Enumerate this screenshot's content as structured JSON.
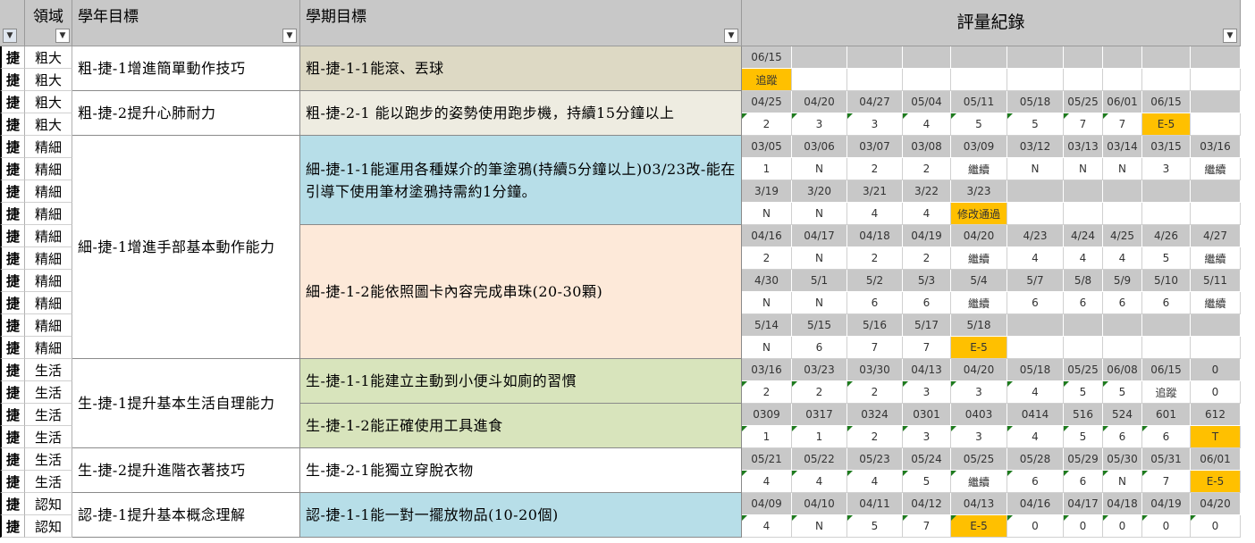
{
  "headers": {
    "domain": "領域",
    "year_goal": "學年目標",
    "semester_goal": "學期目標",
    "evaluation": "評量紀錄",
    "filter_icon": "filter-icon",
    "dropdown_icon": "chevron-down-icon"
  },
  "colors": {
    "header_bg": "#c8c8c8",
    "highlight": "#ffc000",
    "beige": "#ddd9c4",
    "beige_light": "#eeece1",
    "blue": "#b7dee8",
    "peach": "#fde9d9",
    "green": "#d8e4bc",
    "white": "#ffffff",
    "comment_marker": "#1e7b1e"
  },
  "rows": [
    {
      "idx": "捷",
      "domain": "粗大"
    },
    {
      "idx": "捷",
      "domain": "粗大"
    },
    {
      "idx": "捷",
      "domain": "粗大"
    },
    {
      "idx": "捷",
      "domain": "粗大"
    },
    {
      "idx": "捷",
      "domain": "精細"
    },
    {
      "idx": "捷",
      "domain": "精細"
    },
    {
      "idx": "捷",
      "domain": "精細"
    },
    {
      "idx": "捷",
      "domain": "精細"
    },
    {
      "idx": "捷",
      "domain": "精細"
    },
    {
      "idx": "捷",
      "domain": "精細"
    },
    {
      "idx": "捷",
      "domain": "精細"
    },
    {
      "idx": "捷",
      "domain": "精細"
    },
    {
      "idx": "捷",
      "domain": "精細"
    },
    {
      "idx": "捷",
      "domain": "精細"
    },
    {
      "idx": "捷",
      "domain": "生活"
    },
    {
      "idx": "捷",
      "domain": "生活"
    },
    {
      "idx": "捷",
      "domain": "生活"
    },
    {
      "idx": "捷",
      "domain": "生活"
    },
    {
      "idx": "捷",
      "domain": "生活"
    },
    {
      "idx": "捷",
      "domain": "生活"
    },
    {
      "idx": "捷",
      "domain": "認知"
    },
    {
      "idx": "捷",
      "domain": "認知"
    }
  ],
  "year_goals": [
    {
      "text": "粗-捷-1增進簡單動作技巧",
      "start": 0,
      "span": 2
    },
    {
      "text": "粗-捷-2提升心肺耐力",
      "start": 2,
      "span": 2
    },
    {
      "text": "細-捷-1增進手部基本動作能力",
      "start": 4,
      "span": 10
    },
    {
      "text": "生-捷-1提升基本生活自理能力",
      "start": 14,
      "span": 4
    },
    {
      "text": "生-捷-2提升進階衣著技巧",
      "start": 18,
      "span": 2
    },
    {
      "text": "認-捷-1提升基本概念理解",
      "start": 20,
      "span": 2
    }
  ],
  "semester_goals": [
    {
      "text": "粗-捷-1-1能滾、丟球",
      "start": 0,
      "span": 2,
      "color": "beige"
    },
    {
      "text": "粗-捷-2-1 能以跑步的姿勢使用跑步機，持續15分鐘以上",
      "start": 2,
      "span": 2,
      "color": "beige_light"
    },
    {
      "text": "細-捷-1-1能運用各種媒介的筆塗鴉(持續5分鐘以上)03/23改-能在引導下使用筆材塗鴉持需約1分鐘。",
      "start": 4,
      "span": 4,
      "color": "blue"
    },
    {
      "text": "細-捷-1-2能依照圖卡內容完成串珠(20-30顆)",
      "start": 8,
      "span": 6,
      "color": "peach"
    },
    {
      "text": "生-捷-1-1能建立主動到小便斗如廁的習慣",
      "start": 14,
      "span": 2,
      "color": "green"
    },
    {
      "text": "生-捷-1-2能正確使用工具進食",
      "start": 16,
      "span": 2,
      "color": "green"
    },
    {
      "text": "生-捷-2-1能獨立穿脫衣物",
      "start": 18,
      "span": 2,
      "color": "white"
    },
    {
      "text": "認-捷-1-1能一對一擺放物品(10-20個)",
      "start": 20,
      "span": 2,
      "color": "blue"
    }
  ],
  "evaluation": [
    {
      "type": "d",
      "cells": [
        "06/15",
        "",
        "",
        "",
        "",
        "",
        "",
        "",
        "",
        ""
      ]
    },
    {
      "type": "s",
      "cells": [
        "追蹤",
        "",
        "",
        "",
        "",
        "",
        "",
        "",
        "",
        ""
      ],
      "highlight": [
        0
      ]
    },
    {
      "type": "d",
      "cells": [
        "04/25",
        "04/20",
        "04/27",
        "05/04",
        "05/11",
        "05/18",
        "05/25",
        "06/01",
        "06/15",
        ""
      ]
    },
    {
      "type": "s",
      "cells": [
        "2",
        "3",
        "3",
        "4",
        "5",
        "5",
        "7",
        "7",
        "E-5",
        ""
      ],
      "highlight": [
        8
      ],
      "marks": [
        0,
        1,
        2,
        3,
        4,
        5,
        6,
        7
      ]
    },
    {
      "type": "d",
      "cells": [
        "03/05",
        "03/06",
        "03/07",
        "03/08",
        "03/09",
        "03/12",
        "03/13",
        "03/14",
        "03/15",
        "03/16"
      ]
    },
    {
      "type": "s",
      "cells": [
        "1",
        "N",
        "2",
        "2",
        "繼續",
        "N",
        "N",
        "N",
        "3",
        "繼續"
      ]
    },
    {
      "type": "d",
      "cells": [
        "3/19",
        "3/20",
        "3/21",
        "3/22",
        "3/23",
        "",
        "",
        "",
        "",
        ""
      ]
    },
    {
      "type": "s",
      "cells": [
        "N",
        "N",
        "4",
        "4",
        "修改通過",
        "",
        "",
        "",
        "",
        ""
      ],
      "highlight": [
        4
      ]
    },
    {
      "type": "d",
      "cells": [
        "04/16",
        "04/17",
        "04/18",
        "04/19",
        "04/20",
        "4/23",
        "4/24",
        "4/25",
        "4/26",
        "4/27"
      ]
    },
    {
      "type": "s",
      "cells": [
        "2",
        "N",
        "2",
        "2",
        "繼續",
        "4",
        "4",
        "4",
        "5",
        "繼續"
      ]
    },
    {
      "type": "d",
      "cells": [
        "4/30",
        "5/1",
        "5/2",
        "5/3",
        "5/4",
        "5/7",
        "5/8",
        "5/9",
        "5/10",
        "5/11"
      ]
    },
    {
      "type": "s",
      "cells": [
        "N",
        "N",
        "6",
        "6",
        "繼續",
        "6",
        "6",
        "6",
        "6",
        "繼續"
      ]
    },
    {
      "type": "d",
      "cells": [
        "5/14",
        "5/15",
        "5/16",
        "5/17",
        "5/18",
        "",
        "",
        "",
        "",
        ""
      ]
    },
    {
      "type": "s",
      "cells": [
        "N",
        "6",
        "7",
        "7",
        "E-5",
        "",
        "",
        "",
        "",
        ""
      ],
      "highlight": [
        4
      ]
    },
    {
      "type": "d",
      "cells": [
        "03/16",
        "03/23",
        "03/30",
        "04/13",
        "04/20",
        "05/18",
        "05/25",
        "06/08",
        "06/15",
        "0"
      ]
    },
    {
      "type": "s",
      "cells": [
        "2",
        "2",
        "2",
        "3",
        "3",
        "4",
        "5",
        "5",
        "追蹤",
        "0"
      ],
      "marks": [
        0,
        1,
        2,
        3,
        4,
        5,
        6,
        7
      ]
    },
    {
      "type": "d",
      "cells": [
        "0309",
        "0317",
        "0324",
        "0301",
        "0403",
        "0414",
        "516",
        "524",
        "601",
        "612"
      ]
    },
    {
      "type": "s",
      "cells": [
        "1",
        "1",
        "2",
        "3",
        "3",
        "4",
        "5",
        "6",
        "6",
        "T"
      ],
      "highlight": [
        9
      ],
      "marks": [
        0,
        1,
        2,
        3,
        4,
        5,
        6,
        7,
        8
      ]
    },
    {
      "type": "d",
      "cells": [
        "05/21",
        "05/22",
        "05/23",
        "05/24",
        "05/25",
        "05/28",
        "05/29",
        "05/30",
        "05/31",
        "06/01"
      ]
    },
    {
      "type": "s",
      "cells": [
        "4",
        "4",
        "4",
        "5",
        "繼續",
        "6",
        "6",
        "N",
        "7",
        "E-5"
      ],
      "highlight": [
        9
      ],
      "marks": [
        0,
        1,
        2,
        3,
        4,
        5,
        6,
        7,
        8
      ]
    },
    {
      "type": "d",
      "cells": [
        "04/09",
        "04/10",
        "04/11",
        "04/12",
        "04/13",
        "04/16",
        "04/17",
        "04/18",
        "04/19",
        "04/20"
      ]
    },
    {
      "type": "s",
      "cells": [
        "4",
        "N",
        "5",
        "7",
        "E-5",
        "0",
        "0",
        "0",
        "0",
        "0"
      ],
      "highlight": [
        4
      ],
      "marks": [
        0,
        1,
        2,
        3,
        4,
        5,
        6,
        7,
        8,
        9
      ]
    }
  ]
}
